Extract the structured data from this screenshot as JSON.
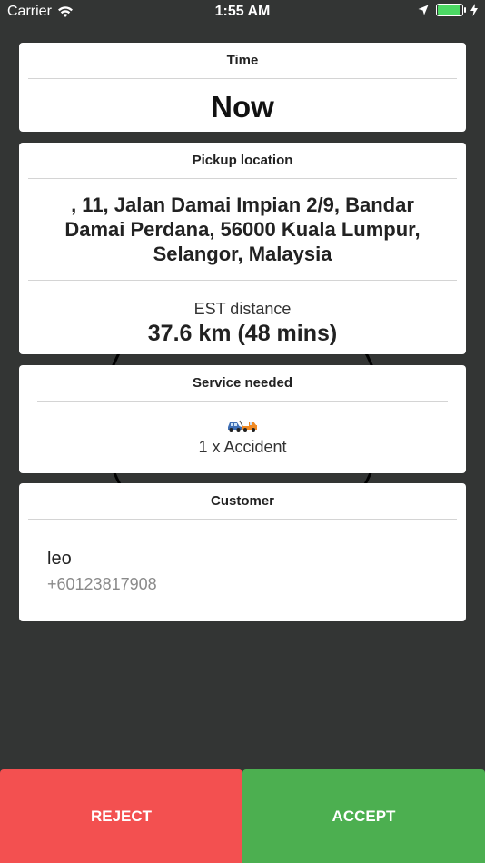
{
  "status_bar": {
    "carrier": "Carrier",
    "time": "1:55 AM",
    "battery_level": 0.95,
    "battery_color": "#4cd964"
  },
  "time_card": {
    "header": "Time",
    "value": "Now"
  },
  "pickup_card": {
    "header": "Pickup location",
    "address": ", 11, Jalan Damai Impian 2/9, Bandar Damai Perdana, 56000 Kuala Lumpur, Selangor, Malaysia",
    "distance_label": "EST distance",
    "distance_value": "37.6 km (48 mins)"
  },
  "service_card": {
    "header": "Service needed",
    "icon": "tow-truck-icon",
    "service": "1 x Accident"
  },
  "customer_card": {
    "header": "Customer",
    "name": "leo",
    "phone": "+60123817908"
  },
  "actions": {
    "reject_label": "REJECT",
    "accept_label": "ACCEPT",
    "reject_color": "#f35050",
    "accept_color": "#4caf50"
  }
}
